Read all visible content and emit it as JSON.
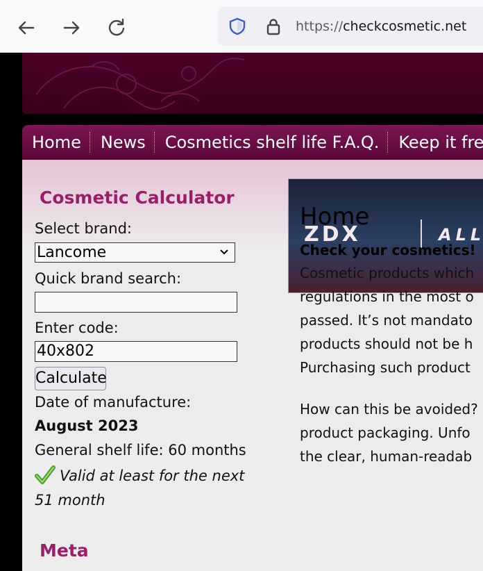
{
  "browser": {
    "url_scheme": "https://",
    "url_host": "checkcosmetic.net",
    "icons": [
      "back-arrow-icon",
      "forward-arrow-icon",
      "reload-icon",
      "shield-icon",
      "lock-icon"
    ]
  },
  "menu": {
    "items": [
      "Home",
      "News",
      "Cosmetics shelf life F.A.Q.",
      "Keep it fre"
    ]
  },
  "sidebar": {
    "title": "Cosmetic Calculator",
    "select_brand_label": "Select brand:",
    "brand_value": "Lancome",
    "quick_search_label": "Quick brand search:",
    "quick_search_value": "",
    "enter_code_label": "Enter code:",
    "code_value": "40x802",
    "calculate_label": "Calculate",
    "date_label": "Date of manufacture:",
    "date_value": "August 2023",
    "shelf_life": "General shelf life: 60 months",
    "valid_line1": "Valid at least for the next",
    "valid_line2": "51 month",
    "meta_title": "Meta"
  },
  "ad": {
    "logo": "ZDX",
    "tag": "ALL"
  },
  "main": {
    "title": "Home",
    "subtitle": "Check your cosmetics!",
    "para1": [
      "Cosmetic products which",
      "regulations in the most o",
      "passed. It’s not mandato",
      "products should not be h",
      "Purchasing such product"
    ],
    "para2": [
      "How can this be avoided?",
      "product packaging. Unfo",
      "the clear, human-readab"
    ]
  },
  "colors": {
    "accent": "#9b1f67",
    "menu_bg": "#6a0e44",
    "header_bg": "#4a0026"
  }
}
